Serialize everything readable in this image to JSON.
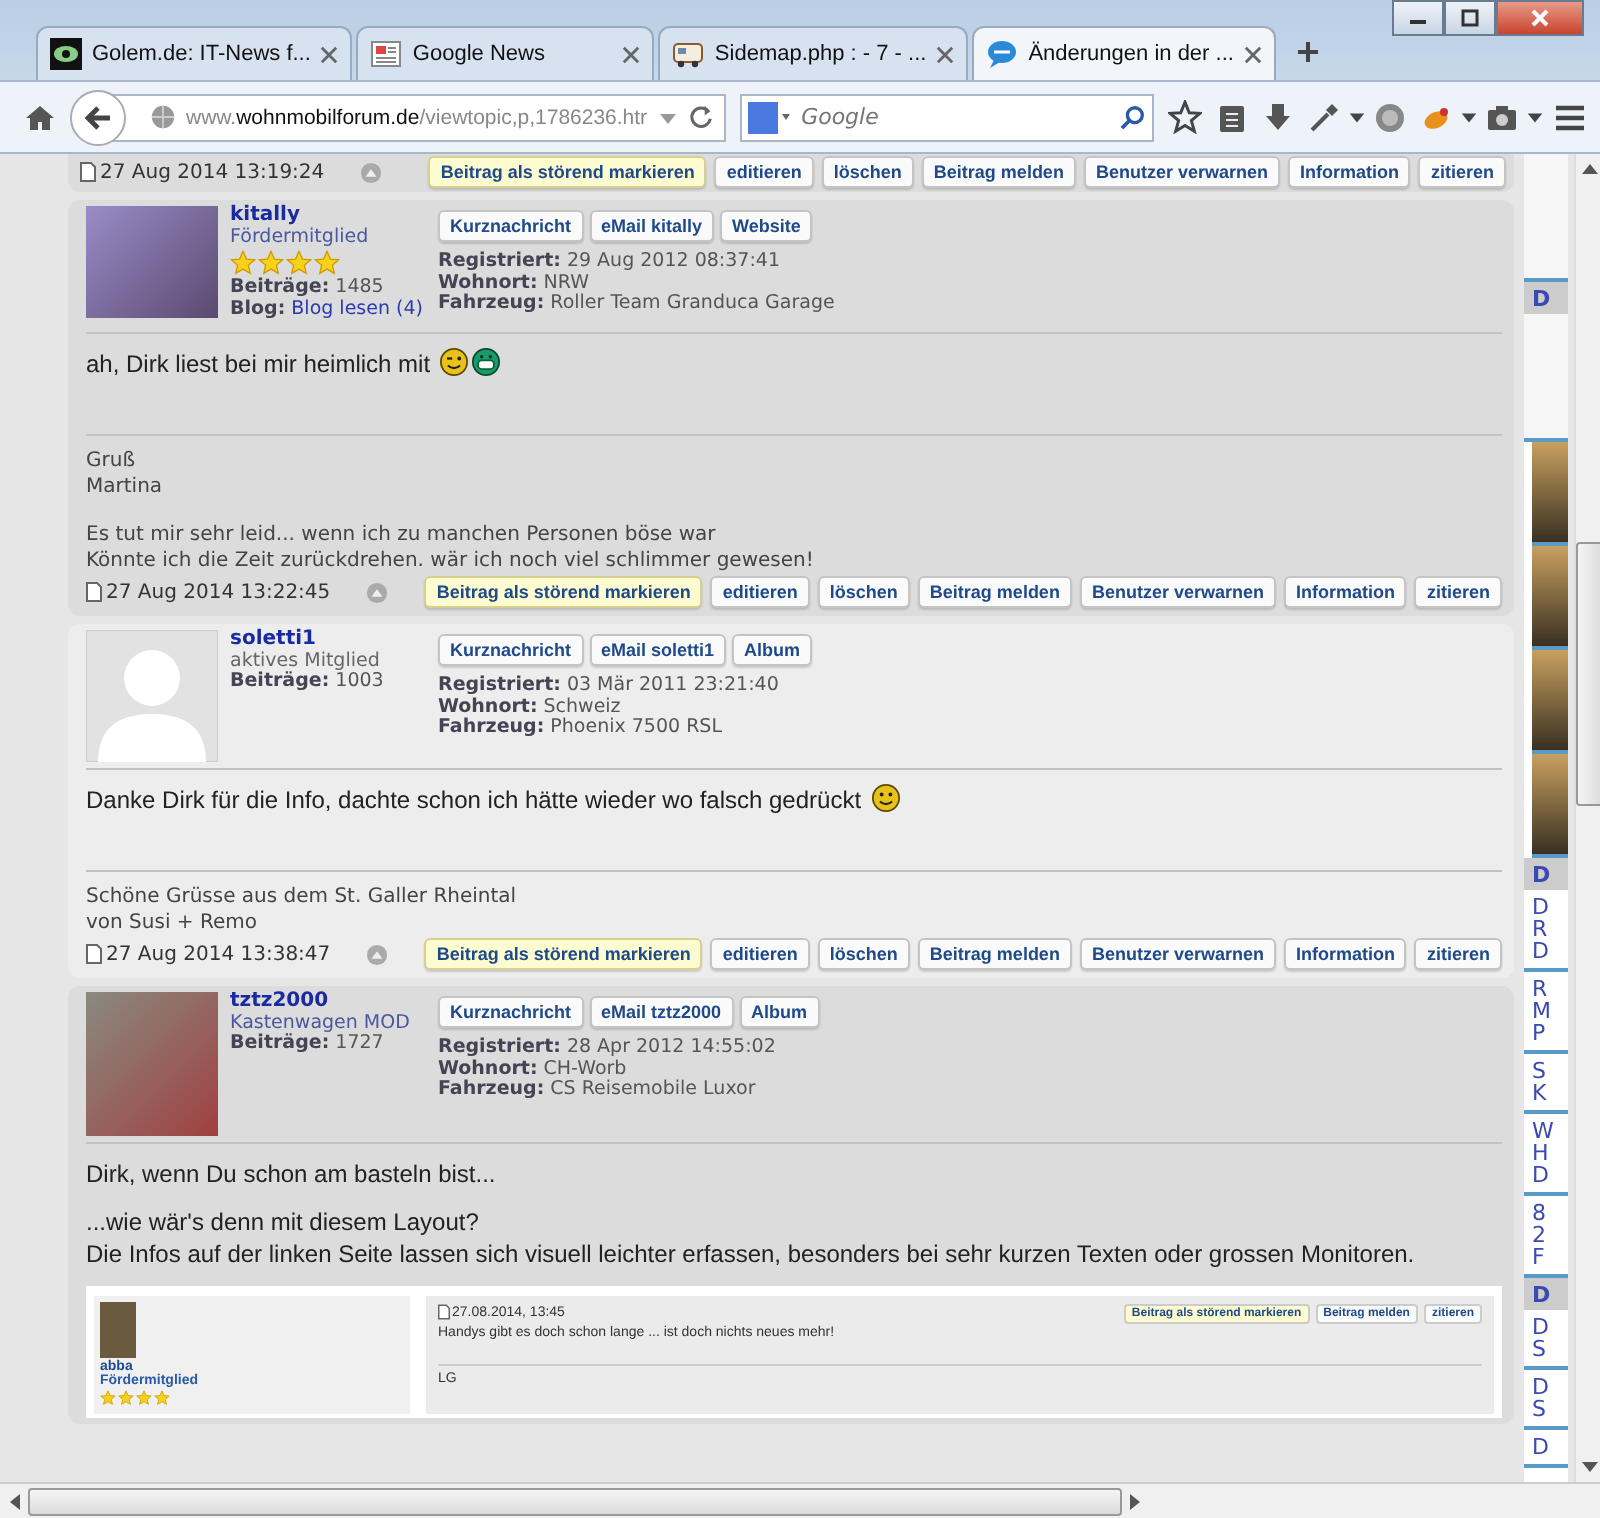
{
  "browser": {
    "tabs": [
      {
        "title": "Golem.de: IT-News f...",
        "selected": false
      },
      {
        "title": "Google News",
        "selected": false
      },
      {
        "title": "Sidemap.php : - 7 - ...",
        "selected": false
      },
      {
        "title": "Änderungen in der ...",
        "selected": true
      }
    ],
    "url": {
      "prefix": "www.",
      "domain": "wohnmobilforum.de",
      "path": "/viewtopic,p,1786236.htr"
    },
    "search": {
      "placeholder": "Google"
    }
  },
  "prev_footer": {
    "date": "27 Aug 2014 13:19:24",
    "buttons": [
      {
        "label": "Beitrag als störend markieren",
        "highlighted": true
      },
      {
        "label": "editieren",
        "highlighted": false
      },
      {
        "label": "löschen",
        "highlighted": false
      },
      {
        "label": "Beitrag melden",
        "highlighted": false
      },
      {
        "label": "Benutzer verwarnen",
        "highlighted": false
      },
      {
        "label": "Information",
        "highlighted": false
      },
      {
        "label": "zitieren",
        "highlighted": false
      }
    ]
  },
  "posts": [
    {
      "alt": false,
      "has_photo": true,
      "author": "kitally",
      "rank": "Fördermitglied",
      "stars": 4,
      "userinfo": [
        {
          "label": "Beiträge:",
          "value": "1485",
          "link": false
        },
        {
          "label": "Blog:",
          "value": "Blog lesen (4)",
          "link": true
        }
      ],
      "profile_buttons": [
        "Kurznachricht",
        "eMail kitally",
        "Website"
      ],
      "fields": [
        {
          "label": "Registriert:",
          "value": "29 Aug 2012 08:37:41"
        },
        {
          "label": "Wohnort:",
          "value": "NRW"
        },
        {
          "label": "Fahrzeug:",
          "value": "Roller Team Granduca Garage"
        }
      ],
      "message": [
        {
          "lines": [
            "ah, Dirk liest bei mir heimlich mit"
          ],
          "smileys": [
            {
              "kind": "wink"
            },
            {
              "kind": "grin"
            }
          ]
        }
      ],
      "signature": [
        [
          "Gruß",
          "Martina"
        ],
        [
          "Es tut mir sehr leid... wenn ich zu manchen Personen böse war",
          "Könnte ich die Zeit zurückdrehen. wär ich noch viel schlimmer gewesen!"
        ]
      ],
      "date": "27 Aug 2014 13:22:45",
      "buttons": [
        {
          "label": "Beitrag als störend markieren",
          "highlighted": true
        },
        {
          "label": "editieren",
          "highlighted": false
        },
        {
          "label": "löschen",
          "highlighted": false
        },
        {
          "label": "Beitrag melden",
          "highlighted": false
        },
        {
          "label": "Benutzer verwarnen",
          "highlighted": false
        },
        {
          "label": "Information",
          "highlighted": false
        },
        {
          "label": "zitieren",
          "highlighted": false
        }
      ]
    },
    {
      "alt": true,
      "has_photo": false,
      "author": "soletti1",
      "rank": "aktives Mitglied",
      "userinfo": [
        {
          "label": "Beiträge:",
          "value": "1003",
          "link": false
        }
      ],
      "profile_buttons": [
        "Kurznachricht",
        "eMail soletti1",
        "Album"
      ],
      "fields": [
        {
          "label": "Registriert:",
          "value": "03 Mär 2011 23:21:40"
        },
        {
          "label": "Wohnort:",
          "value": "Schweiz"
        },
        {
          "label": "Fahrzeug:",
          "value": "Phoenix 7500 RSL"
        }
      ],
      "message": [
        {
          "lines": [
            "Danke Dirk für die Info, dachte schon ich hätte wieder wo falsch gedrückt"
          ],
          "smileys": [
            {
              "kind": "smile"
            }
          ]
        }
      ],
      "signature": [
        [
          "Schöne Grüsse aus dem St. Galler Rheintal",
          "von Susi + Remo"
        ]
      ],
      "date": "27 Aug 2014 13:38:47",
      "buttons": [
        {
          "label": "Beitrag als störend markieren",
          "highlighted": true
        },
        {
          "label": "editieren",
          "highlighted": false
        },
        {
          "label": "löschen",
          "highlighted": false
        },
        {
          "label": "Beitrag melden",
          "highlighted": false
        },
        {
          "label": "Benutzer verwarnen",
          "highlighted": false
        },
        {
          "label": "Information",
          "highlighted": false
        },
        {
          "label": "zitieren",
          "highlighted": false
        }
      ]
    },
    {
      "alt": false,
      "has_photo": true,
      "author": "tztz2000",
      "rank": "Kastenwagen MOD",
      "userinfo": [
        {
          "label": "Beiträge:",
          "value": "1727",
          "link": false
        }
      ],
      "profile_buttons": [
        "Kurznachricht",
        "eMail tztz2000",
        "Album"
      ],
      "fields": [
        {
          "label": "Registriert:",
          "value": "28 Apr 2012 14:55:02"
        },
        {
          "label": "Wohnort:",
          "value": "CH-Worb"
        },
        {
          "label": "Fahrzeug:",
          "value": "CS Reisemobile Luxor"
        }
      ],
      "message": [
        {
          "lines": [
            "Dirk, wenn Du schon am basteln bist..."
          ]
        },
        {
          "lines": [
            "...wie wär's denn mit diesem Layout?",
            "Die Infos auf der linken Seite lassen sich visuell leichter erfassen, besonders bei sehr kurzen Texten oder grossen Monitoren."
          ]
        }
      ],
      "embedded": {
        "author": "abba",
        "rank": "Fördermitglied",
        "stars": 4,
        "date": "27.08.2014, 13:45",
        "buttons": [
          {
            "label": "Beitrag als störend markieren",
            "highlighted": true
          },
          {
            "label": "Beitrag melden",
            "highlighted": false
          },
          {
            "label": "zitieren",
            "highlighted": false
          }
        ],
        "text": "Handys gibt es doch schon lange ... ist doch nichts neues mehr!",
        "signature": "LG"
      }
    }
  ],
  "sidebar": [
    {
      "kind": "blank"
    },
    {
      "kind": "header",
      "lines": [
        "D"
      ]
    },
    {
      "kind": "blank"
    },
    {
      "kind": "photo"
    },
    {
      "kind": "photo"
    },
    {
      "kind": "photo"
    },
    {
      "kind": "photo"
    },
    {
      "kind": "header",
      "lines": [
        "D"
      ]
    },
    {
      "kind": "links",
      "lines": [
        "D",
        "R",
        "D"
      ]
    },
    {
      "kind": "links",
      "lines": [
        "R",
        "M",
        "P"
      ]
    },
    {
      "kind": "links",
      "lines": [
        "S",
        "K"
      ]
    },
    {
      "kind": "links",
      "lines": [
        "W",
        "H",
        "D"
      ]
    },
    {
      "kind": "links",
      "lines": [
        "8",
        "2",
        "F"
      ]
    },
    {
      "kind": "header",
      "lines": [
        "D"
      ]
    },
    {
      "kind": "links",
      "lines": [
        "D",
        "S"
      ]
    },
    {
      "kind": "links",
      "lines": [
        "D",
        "S"
      ]
    },
    {
      "kind": "links",
      "lines": [
        "D"
      ]
    }
  ]
}
